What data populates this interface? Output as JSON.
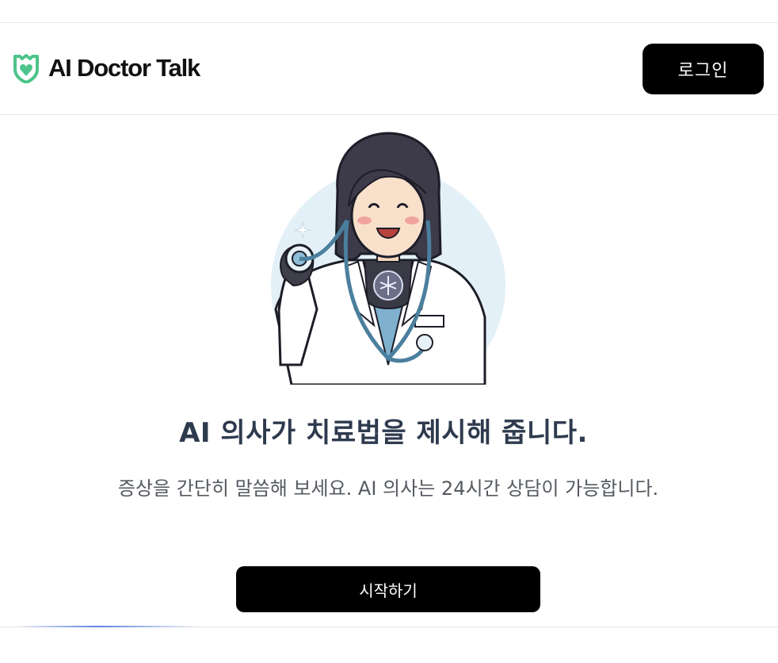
{
  "header": {
    "brand": "AI Doctor Talk",
    "logo_icon": "shield-heart-icon",
    "login_label": "로그인"
  },
  "hero": {
    "illustration": "doctor-illustration",
    "title": "AI 의사가 치료법을 제시해 줍니다.",
    "subtitle": "증상을 간단히 말씀해 보세요. AI 의사는 24시간 상담이 가능합니다.",
    "start_label": "시작하기"
  },
  "colors": {
    "brand_green": "#4cc48b",
    "button_bg": "#000000",
    "title_text": "#2e3a4e",
    "body_text": "#555a60",
    "accent_blue": "#5b84e6"
  }
}
